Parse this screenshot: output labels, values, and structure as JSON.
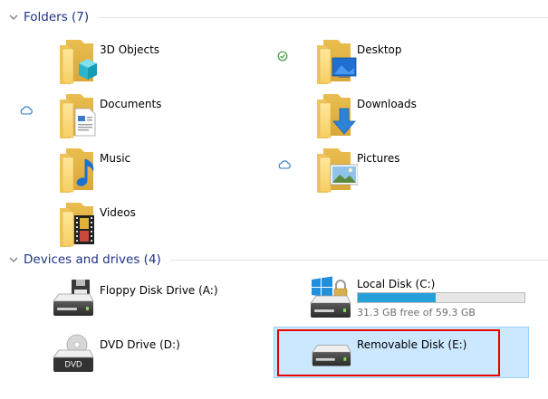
{
  "groups": {
    "folders": {
      "title": "Folders (7)"
    },
    "devices": {
      "title": "Devices and drives (4)"
    }
  },
  "folders": [
    {
      "label": "3D Objects",
      "icon": "3d-objects-folder-icon"
    },
    {
      "label": "Desktop",
      "icon": "desktop-folder-icon",
      "status": "synced-check"
    },
    {
      "label": "Documents",
      "icon": "documents-folder-icon",
      "status": "cloud"
    },
    {
      "label": "Downloads",
      "icon": "downloads-folder-icon"
    },
    {
      "label": "Music",
      "icon": "music-folder-icon"
    },
    {
      "label": "Pictures",
      "icon": "pictures-folder-icon",
      "status": "cloud"
    },
    {
      "label": "Videos",
      "icon": "videos-folder-icon"
    }
  ],
  "drives": [
    {
      "label": "Floppy Disk Drive (A:)",
      "icon": "floppy-drive-icon"
    },
    {
      "label": "Local Disk (C:)",
      "icon": "local-disk-icon",
      "space_text": "31.3 GB free of 59.3 GB",
      "used_fraction": 0.47
    },
    {
      "label": "DVD Drive (D:)",
      "icon": "dvd-drive-icon",
      "dvd_text": "DVD"
    },
    {
      "label": "Removable Disk (E:)",
      "icon": "removable-disk-icon",
      "selected": true
    }
  ],
  "colors": {
    "group_title": "#1e3287",
    "usage_bar": "#26a0da",
    "selection": "#cce8ff",
    "highlight_box": "#e60000",
    "sync_check": "#3a9a3a",
    "cloud": "#2b78c5"
  }
}
